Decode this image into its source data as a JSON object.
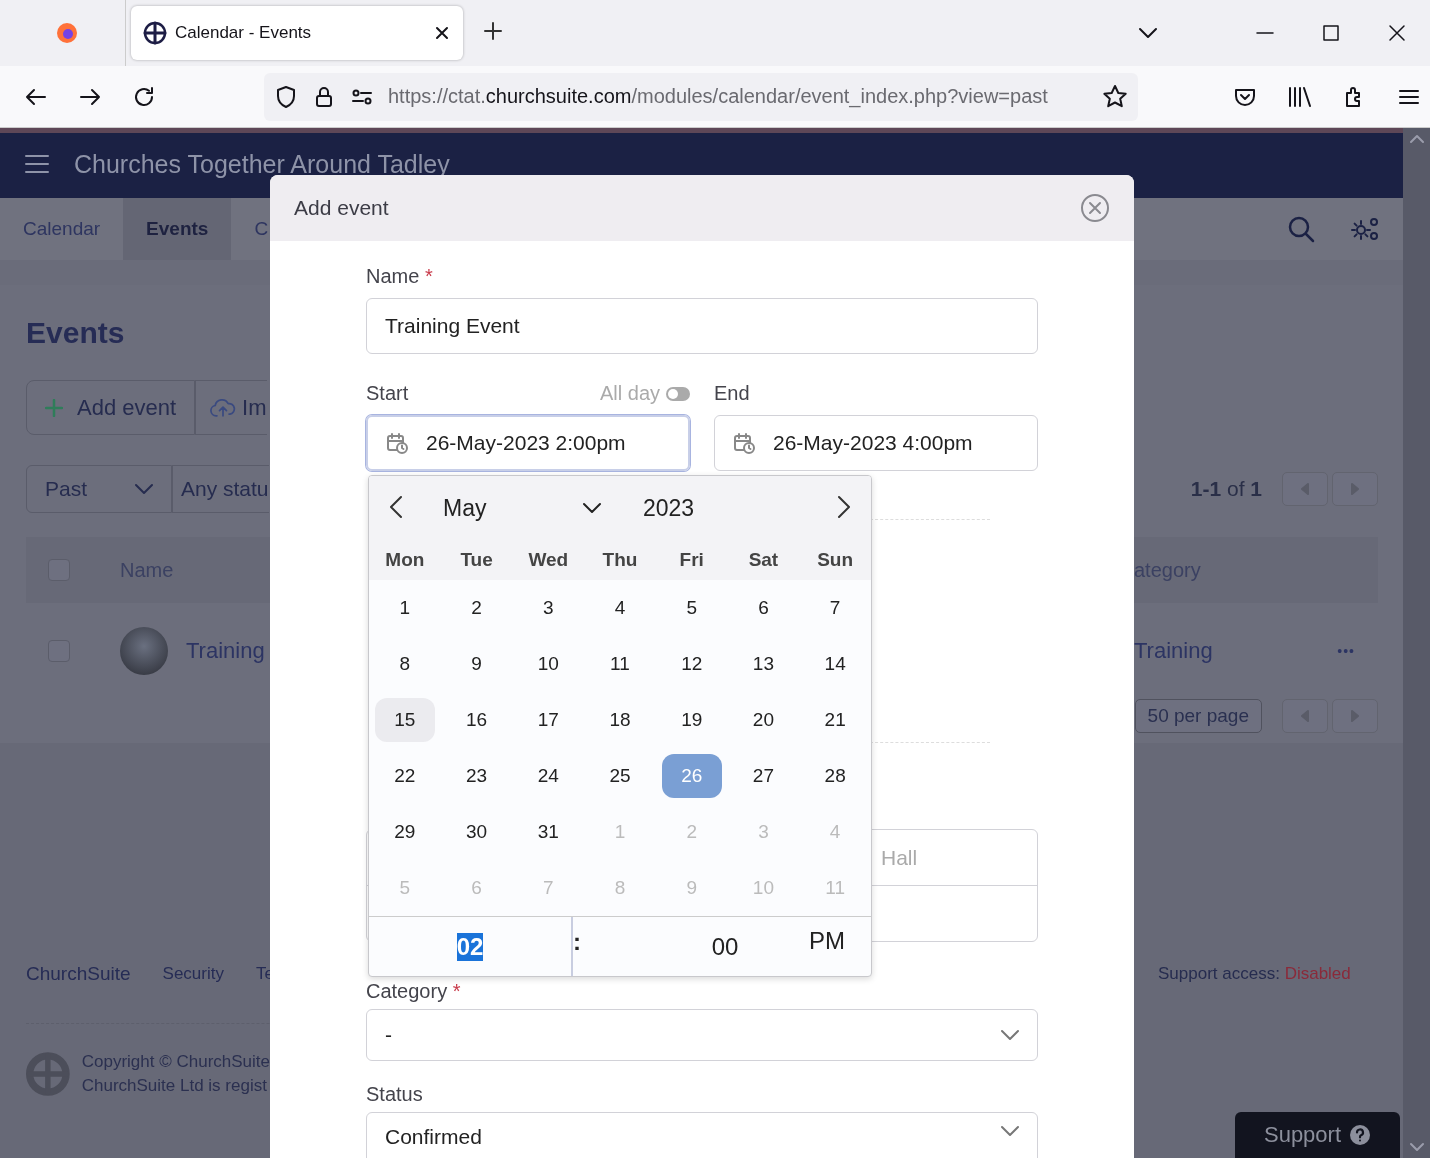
{
  "browser": {
    "tab": {
      "title": "Calendar - Events"
    },
    "url": {
      "scheme": "https://ctat.",
      "domain": "churchsuite.com",
      "path": "/modules/calendar/event_index.php?view=past"
    }
  },
  "app": {
    "title": "Churches Together Around Tadley",
    "tabs": [
      {
        "label": "Calendar",
        "selected": false
      },
      {
        "label": "Events",
        "selected": true
      },
      {
        "label": "C",
        "selected": false
      }
    ],
    "heading": "Events",
    "actions": [
      {
        "kind": "add",
        "label": "Add event"
      },
      {
        "kind": "import",
        "label": "Im"
      }
    ],
    "filters": [
      {
        "label": "Past",
        "kind": "dropdown"
      },
      {
        "label": "Any statu",
        "kind": "plain"
      }
    ],
    "pagination": "**1-1** of **1**",
    "table": {
      "select_all": {
        "checked": false
      },
      "columns": [
        "Name",
        "ategory"
      ],
      "rows": [
        {
          "checked": false,
          "name": "Training",
          "category": "Training",
          "menu": "•••"
        }
      ]
    },
    "per_page": "50 per page",
    "footer": {
      "links": [
        "ChurchSuite",
        "Security",
        "Te"
      ],
      "support_access": {
        "label": "Support access:",
        "value": "Disabled"
      },
      "copyright": [
        "Copyright © ChurchSuite",
        "ChurchSuite Ltd is regist"
      ]
    },
    "support_button": "Support"
  },
  "modal": {
    "title": "Add event",
    "name": {
      "label": "Name",
      "required": true,
      "required_marker": "*",
      "value": "Training Event"
    },
    "start": {
      "label": "Start",
      "value": "26-May-2023 2:00pm",
      "focused": true
    },
    "all_day": {
      "label": "All day",
      "on": false
    },
    "end": {
      "label": "End",
      "value": "26-May-2023 4:00pm"
    },
    "location": {
      "placeholder": "Hall"
    },
    "category": {
      "label": "Category",
      "required": true,
      "required_marker": "*",
      "value": "-"
    },
    "status": {
      "label": "Status",
      "value": "Confirmed"
    }
  },
  "datepicker": {
    "month": "May",
    "year": "2023",
    "weekdays": [
      "Mon",
      "Tue",
      "Wed",
      "Thu",
      "Fri",
      "Sat",
      "Sun"
    ],
    "weeks": [
      [
        {
          "label": "1",
          "outside": false,
          "today": false,
          "selected": false
        },
        {
          "label": "2",
          "outside": false,
          "today": false,
          "selected": false
        },
        {
          "label": "3",
          "outside": false,
          "today": false,
          "selected": false
        },
        {
          "label": "4",
          "outside": false,
          "today": false,
          "selected": false
        },
        {
          "label": "5",
          "outside": false,
          "today": false,
          "selected": false
        },
        {
          "label": "6",
          "outside": false,
          "today": false,
          "selected": false
        },
        {
          "label": "7",
          "outside": false,
          "today": false,
          "selected": false
        }
      ],
      [
        {
          "label": "8",
          "outside": false,
          "today": false,
          "selected": false
        },
        {
          "label": "9",
          "outside": false,
          "today": false,
          "selected": false
        },
        {
          "label": "10",
          "outside": false,
          "today": false,
          "selected": false
        },
        {
          "label": "11",
          "outside": false,
          "today": false,
          "selected": false
        },
        {
          "label": "12",
          "outside": false,
          "today": false,
          "selected": false
        },
        {
          "label": "13",
          "outside": false,
          "today": false,
          "selected": false
        },
        {
          "label": "14",
          "outside": false,
          "today": false,
          "selected": false
        }
      ],
      [
        {
          "label": "15",
          "outside": false,
          "today": true,
          "selected": false
        },
        {
          "label": "16",
          "outside": false,
          "today": false,
          "selected": false
        },
        {
          "label": "17",
          "outside": false,
          "today": false,
          "selected": false
        },
        {
          "label": "18",
          "outside": false,
          "today": false,
          "selected": false
        },
        {
          "label": "19",
          "outside": false,
          "today": false,
          "selected": false
        },
        {
          "label": "20",
          "outside": false,
          "today": false,
          "selected": false
        },
        {
          "label": "21",
          "outside": false,
          "today": false,
          "selected": false
        }
      ],
      [
        {
          "label": "22",
          "outside": false,
          "today": false,
          "selected": false
        },
        {
          "label": "23",
          "outside": false,
          "today": false,
          "selected": false
        },
        {
          "label": "24",
          "outside": false,
          "today": false,
          "selected": false
        },
        {
          "label": "25",
          "outside": false,
          "today": false,
          "selected": false
        },
        {
          "label": "26",
          "outside": false,
          "today": false,
          "selected": true
        },
        {
          "label": "27",
          "outside": false,
          "today": false,
          "selected": false
        },
        {
          "label": "28",
          "outside": false,
          "today": false,
          "selected": false
        }
      ],
      [
        {
          "label": "29",
          "outside": false,
          "today": false,
          "selected": false
        },
        {
          "label": "30",
          "outside": false,
          "today": false,
          "selected": false
        },
        {
          "label": "31",
          "outside": false,
          "today": false,
          "selected": false
        },
        {
          "label": "1",
          "outside": true,
          "today": false,
          "selected": false
        },
        {
          "label": "2",
          "outside": true,
          "today": false,
          "selected": false
        },
        {
          "label": "3",
          "outside": true,
          "today": false,
          "selected": false
        },
        {
          "label": "4",
          "outside": true,
          "today": false,
          "selected": false
        }
      ],
      [
        {
          "label": "5",
          "outside": true,
          "today": false,
          "selected": false
        },
        {
          "label": "6",
          "outside": true,
          "today": false,
          "selected": false
        },
        {
          "label": "7",
          "outside": true,
          "today": false,
          "selected": false
        },
        {
          "label": "8",
          "outside": true,
          "today": false,
          "selected": false
        },
        {
          "label": "9",
          "outside": true,
          "today": false,
          "selected": false
        },
        {
          "label": "10",
          "outside": true,
          "today": false,
          "selected": false
        },
        {
          "label": "11",
          "outside": true,
          "today": false,
          "selected": false
        }
      ]
    ],
    "time": {
      "hour": {
        "value": "02",
        "selected": true
      },
      "separator": ":",
      "minute": "00",
      "period": "PM"
    }
  }
}
